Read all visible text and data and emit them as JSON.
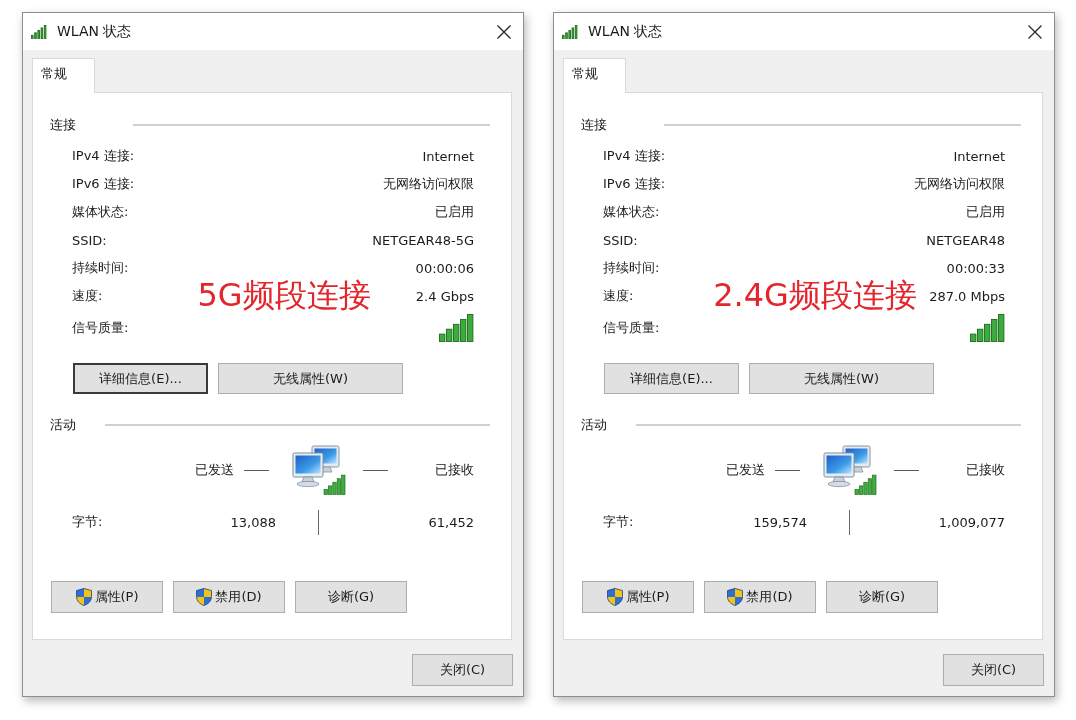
{
  "dialogs": [
    {
      "title": "WLAN 状态",
      "tabs": [
        {
          "label": "常规",
          "selected": true
        }
      ],
      "connection": {
        "heading": "连接",
        "rows": [
          {
            "kind": "text",
            "label": "IPv4 连接:",
            "value": "Internet"
          },
          {
            "kind": "text",
            "label": "IPv6 连接:",
            "value": "无网络访问权限"
          },
          {
            "kind": "text",
            "label": "媒体状态:",
            "value": "已启用"
          },
          {
            "kind": "text",
            "label": "SSID:",
            "value": "NETGEAR48-5G"
          },
          {
            "kind": "text",
            "label": "持续时间:",
            "value": "00:00:06"
          },
          {
            "kind": "text",
            "label": "速度:",
            "value": "2.4 Gbps",
            "annotation": "5G频段连接"
          },
          {
            "kind": "signal",
            "label": "信号质量:"
          }
        ],
        "buttons": [
          {
            "label": "详细信息(E)...",
            "focused": true
          },
          {
            "label": "无线属性(W)",
            "focused": false
          }
        ]
      },
      "activity": {
        "heading": "活动",
        "sent_label": "已发送",
        "received_label": "已接收",
        "bytes_label": "字节:",
        "bytes_sent": "13,088",
        "bytes_received": "61,452"
      },
      "action_buttons": [
        {
          "label": "属性(P)",
          "shield": true
        },
        {
          "label": "禁用(D)",
          "shield": true
        },
        {
          "label": "诊断(G)",
          "shield": false
        }
      ],
      "close_button": {
        "label": "关闭(C)"
      }
    },
    {
      "title": "WLAN 状态",
      "tabs": [
        {
          "label": "常规",
          "selected": true
        }
      ],
      "connection": {
        "heading": "连接",
        "rows": [
          {
            "kind": "text",
            "label": "IPv4 连接:",
            "value": "Internet"
          },
          {
            "kind": "text",
            "label": "IPv6 连接:",
            "value": "无网络访问权限"
          },
          {
            "kind": "text",
            "label": "媒体状态:",
            "value": "已启用"
          },
          {
            "kind": "text",
            "label": "SSID:",
            "value": "NETGEAR48"
          },
          {
            "kind": "text",
            "label": "持续时间:",
            "value": "00:00:33"
          },
          {
            "kind": "text",
            "label": "速度:",
            "value": "287.0 Mbps",
            "annotation": "2.4G频段连接"
          },
          {
            "kind": "signal",
            "label": "信号质量:"
          }
        ],
        "buttons": [
          {
            "label": "详细信息(E)...",
            "focused": false
          },
          {
            "label": "无线属性(W)",
            "focused": false
          }
        ]
      },
      "activity": {
        "heading": "活动",
        "sent_label": "已发送",
        "received_label": "已接收",
        "bytes_label": "字节:",
        "bytes_sent": "159,574",
        "bytes_received": "1,009,077"
      },
      "action_buttons": [
        {
          "label": "属性(P)",
          "shield": true
        },
        {
          "label": "禁用(D)",
          "shield": true
        },
        {
          "label": "诊断(G)",
          "shield": false
        }
      ],
      "close_button": {
        "label": "关闭(C)"
      }
    }
  ]
}
